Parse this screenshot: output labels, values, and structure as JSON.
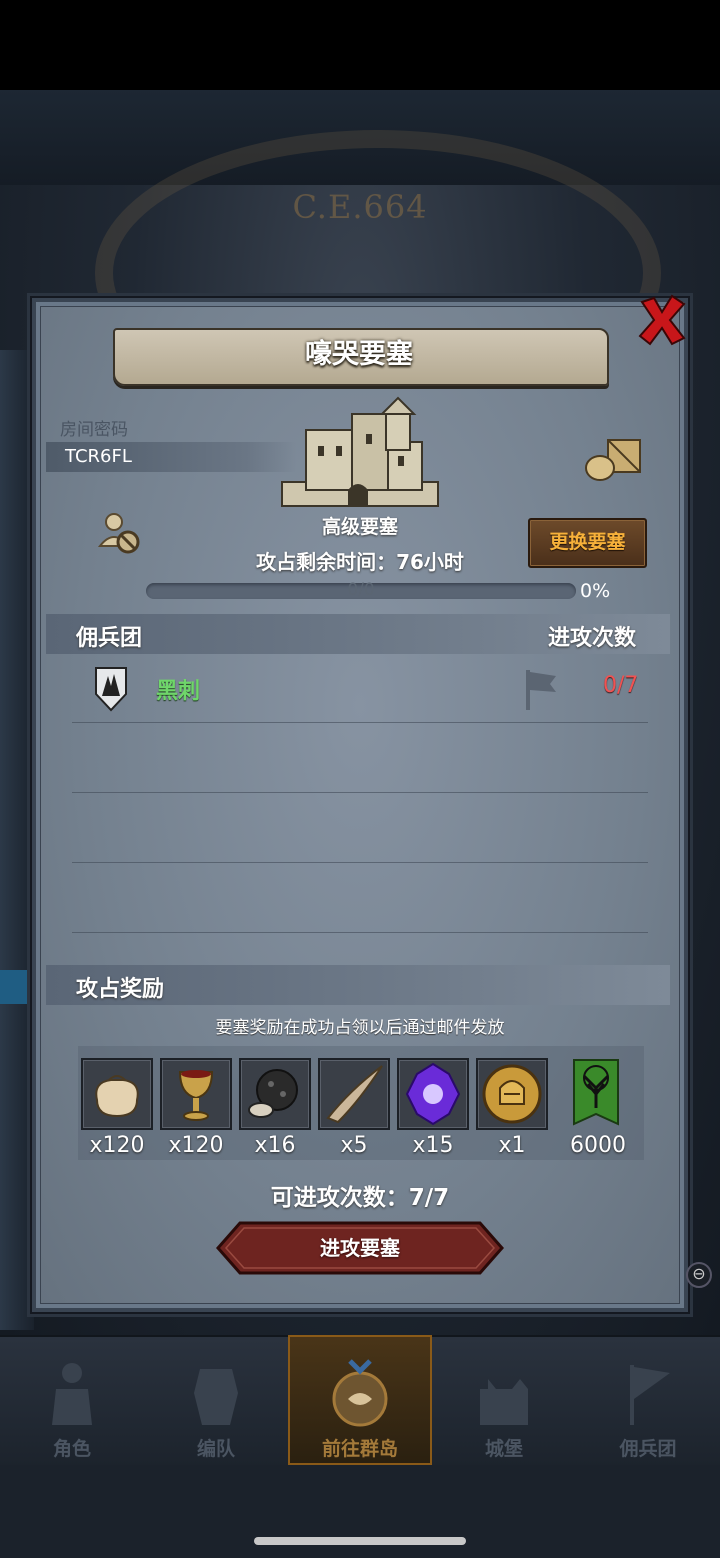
{
  "background": {
    "era_text": "C.E.664"
  },
  "dialog": {
    "title": "嚎哭要塞",
    "room_code_label": "房间密码",
    "room_code": "TCR6FL",
    "fortress_grade": "高级要塞",
    "change_fortress_label": "更换要塞",
    "remaining_time": "攻占剩余时间：76小时",
    "progress": {
      "text": "0/0",
      "percent_text": "0%",
      "value": 0
    },
    "mercenary_section": {
      "title": "佣兵团",
      "attacks_header": "进攻次数",
      "rows": [
        {
          "name": "黑刺",
          "attacks": "0/7"
        }
      ]
    },
    "reward_section": {
      "title": "攻占奖励",
      "note": "要塞奖励在成功占领以后通过邮件发放",
      "items": [
        {
          "icon": "sack-icon",
          "qty": "x120"
        },
        {
          "icon": "goblet-icon",
          "qty": "x120"
        },
        {
          "icon": "ore-icon",
          "qty": "x16"
        },
        {
          "icon": "horn-icon",
          "qty": "x5"
        },
        {
          "icon": "purple-gem-icon",
          "qty": "x15"
        },
        {
          "icon": "helmet-coin-icon",
          "qty": "x1"
        },
        {
          "icon": "tree-banner-icon",
          "qty": "6000"
        }
      ]
    },
    "attacks_available": "可进攻次数：7/7",
    "attack_button_label": "进攻要塞"
  },
  "nav": {
    "items": [
      {
        "label": "角色",
        "active": false
      },
      {
        "label": "编队",
        "active": false
      },
      {
        "label": "前往群岛",
        "active": true
      },
      {
        "label": "城堡",
        "active": false
      },
      {
        "label": "佣兵团",
        "active": false
      }
    ]
  },
  "colors": {
    "guild_name": "#6fd66a",
    "attack_count": "#f05252",
    "change_button_text": "#f7b13a",
    "attack_button": "#6e2420"
  }
}
